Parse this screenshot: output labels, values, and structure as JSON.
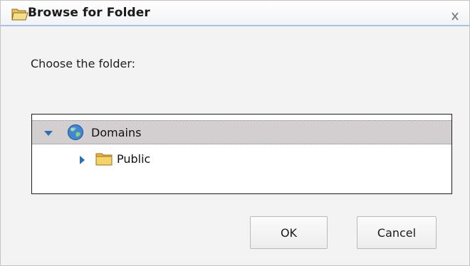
{
  "dialog": {
    "title": "Browse for Folder",
    "close_label": "X",
    "prompt": "Choose the folder:"
  },
  "tree": {
    "nodes": [
      {
        "label": "Domains",
        "icon": "globe-icon",
        "expanded": true,
        "selected": true
      },
      {
        "label": "Public",
        "icon": "folder-icon",
        "expanded": false,
        "selected": false
      }
    ]
  },
  "buttons": {
    "ok_label": "OK",
    "cancel_label": "Cancel"
  },
  "colors": {
    "selection": "#d3cfd0",
    "title_underline": "#a9c3e8",
    "globe_blue": "#2f6fc1",
    "folder_yellow": "#f0c75a"
  }
}
